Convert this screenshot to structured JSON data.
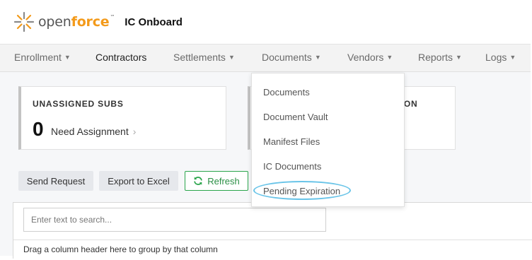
{
  "app": {
    "logo_prefix": "open",
    "logo_suffix": "force",
    "logo_tm": "™",
    "title": "IC Onboard"
  },
  "nav": {
    "items": [
      {
        "label": "Enrollment",
        "caret": true
      },
      {
        "label": "Contractors",
        "caret": false
      },
      {
        "label": "Settlements",
        "caret": true
      },
      {
        "label": "Documents",
        "caret": true
      },
      {
        "label": "Vendors",
        "caret": true
      },
      {
        "label": "Reports",
        "caret": true
      },
      {
        "label": "Logs",
        "caret": true
      }
    ],
    "active": "Contractors"
  },
  "cards": {
    "unassigned": {
      "title": "UNASSIGNED SUBS",
      "count": "0",
      "subtitle": "Need Assignment"
    },
    "expiration": {
      "title_visible": "ATION"
    }
  },
  "actions": {
    "send_request": "Send Request",
    "export_excel": "Export to Excel",
    "refresh": "Refresh"
  },
  "grid": {
    "search_placeholder": "Enter text to search...",
    "group_hint": "Drag a column header here to group by that column"
  },
  "documents_menu": {
    "items": [
      "Documents",
      "Document Vault",
      "Manifest Files",
      "IC Documents",
      "Pending Expiration"
    ],
    "highlighted": "Pending Expiration"
  },
  "colors": {
    "brand_orange": "#f39a1a",
    "frame_border": "#f0b43c",
    "refresh_green": "#2aa54b",
    "highlight_blue": "#69c4e8"
  },
  "icons": {
    "logo": "openforce-star-icon",
    "refresh": "refresh-icon",
    "caret": "caret-down-icon",
    "chevron": "chevron-right-icon"
  }
}
